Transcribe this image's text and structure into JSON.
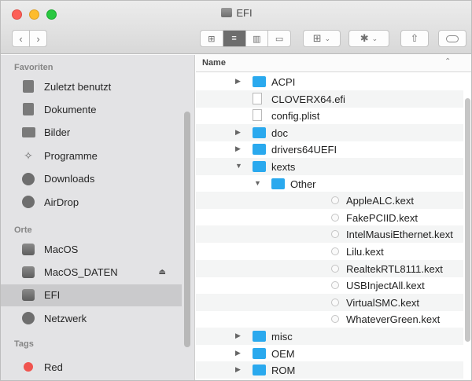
{
  "window": {
    "title": "EFI"
  },
  "toolbar": {
    "back_glyph": "‹",
    "forward_glyph": "›",
    "view_modes": [
      {
        "name": "icon-view",
        "glyph": "⊞",
        "active": false
      },
      {
        "name": "list-view",
        "glyph": "≡",
        "active": true
      },
      {
        "name": "column-view",
        "glyph": "▥",
        "active": false
      },
      {
        "name": "gallery-view",
        "glyph": "▭",
        "active": false
      }
    ],
    "group_glyph": "⊞",
    "action_glyph": "✱",
    "chevron_glyph": "⌄",
    "share_glyph": "⇧"
  },
  "sidebar": {
    "sections": [
      {
        "heading": "Favoriten",
        "items": [
          {
            "label": "Zuletzt benutzt",
            "icon": "clock-icon"
          },
          {
            "label": "Dokumente",
            "icon": "document-icon"
          },
          {
            "label": "Bilder",
            "icon": "camera-icon"
          },
          {
            "label": "Programme",
            "icon": "applications-icon"
          },
          {
            "label": "Downloads",
            "icon": "download-icon"
          },
          {
            "label": "AirDrop",
            "icon": "airdrop-icon"
          }
        ]
      },
      {
        "heading": "Orte",
        "items": [
          {
            "label": "MacOS",
            "icon": "disk-icon"
          },
          {
            "label": "MacOS_DATEN",
            "icon": "disk-icon",
            "eject": "⏏"
          },
          {
            "label": "EFI",
            "icon": "disk-icon",
            "selected": true
          },
          {
            "label": "Netzwerk",
            "icon": "network-icon"
          }
        ]
      },
      {
        "heading": "Tags",
        "items": [
          {
            "label": "Red",
            "icon": "red-tag-icon",
            "color": "#f0544f"
          }
        ]
      }
    ]
  },
  "file_list": {
    "column_header": "Name",
    "sort_glyph": "⌃",
    "rows": [
      {
        "name": "ACPI",
        "type": "folder",
        "depth": 0,
        "disclosure": "collapsed"
      },
      {
        "name": "CLOVERX64.efi",
        "type": "file",
        "depth": 0
      },
      {
        "name": "config.plist",
        "type": "file",
        "depth": 0
      },
      {
        "name": "doc",
        "type": "folder",
        "depth": 0,
        "disclosure": "collapsed"
      },
      {
        "name": "drivers64UEFI",
        "type": "folder",
        "depth": 0,
        "disclosure": "collapsed"
      },
      {
        "name": "kexts",
        "type": "folder",
        "depth": 0,
        "disclosure": "expanded"
      },
      {
        "name": "Other",
        "type": "folder",
        "depth": 1,
        "disclosure": "expanded"
      },
      {
        "name": "AppleALC.kext",
        "type": "kext",
        "depth": 2
      },
      {
        "name": "FakePCIID.kext",
        "type": "kext",
        "depth": 2
      },
      {
        "name": "IntelMausiEthernet.kext",
        "type": "kext",
        "depth": 2
      },
      {
        "name": "Lilu.kext",
        "type": "kext",
        "depth": 2
      },
      {
        "name": "RealtekRTL8111.kext",
        "type": "kext",
        "depth": 2
      },
      {
        "name": "USBInjectAll.kext",
        "type": "kext",
        "depth": 2
      },
      {
        "name": "VirtualSMC.kext",
        "type": "kext",
        "depth": 2
      },
      {
        "name": "WhateverGreen.kext",
        "type": "kext",
        "depth": 2
      },
      {
        "name": "misc",
        "type": "folder",
        "depth": 0,
        "disclosure": "collapsed"
      },
      {
        "name": "OEM",
        "type": "folder",
        "depth": 0,
        "disclosure": "collapsed"
      },
      {
        "name": "ROM",
        "type": "folder",
        "depth": 0,
        "disclosure": "collapsed"
      }
    ]
  },
  "colors": {
    "folder": "#2aa9ee",
    "selection": "#cacacc",
    "sidebar_bg": "#e3e3e5"
  }
}
